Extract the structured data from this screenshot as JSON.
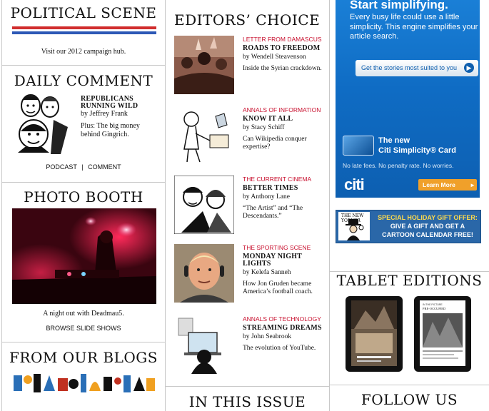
{
  "political_scene": {
    "heading": "Political Scene",
    "caption": "Visit our 2012 campaign hub.",
    "flag_colors": [
      "#d12d2d",
      "#ffffff",
      "#2d58b6"
    ]
  },
  "daily_comment": {
    "heading": "Daily Comment",
    "title": "Republicans Running Wild",
    "byline": "by Jeffrey Frank",
    "plus": "Plus: The big money behind Gingrich.",
    "links": [
      "PODCAST",
      "COMMENT"
    ],
    "separator": "|"
  },
  "photo_booth": {
    "heading": "Photo Booth",
    "caption": "A night out with Deadmau5.",
    "link": "BROWSE SLIDE SHOWS"
  },
  "blogs": {
    "heading": "From Our Blogs"
  },
  "editors_choice": {
    "heading": "Editors’ Choice",
    "items": [
      {
        "kicker": "Letter from Damascus",
        "title": "Roads to Freedom",
        "byline": "by Wendell Steavenson",
        "dek": "Inside the Syrian crackdown."
      },
      {
        "kicker": "Annals of Information",
        "title": "Know It All",
        "byline": "by Stacy Schiff",
        "dek": "Can Wikipedia conquer expertise?"
      },
      {
        "kicker": "The Current Cinema",
        "title": "Better Times",
        "byline": "by Anthony Lane",
        "dek": "“The Artist” and “The Descendants.”"
      },
      {
        "kicker": "The Sporting Scene",
        "title": "Monday Night Lights",
        "byline": "by Kelefa Sanneh",
        "dek": "How Jon Gruden became America’s football coach."
      },
      {
        "kicker": "Annals of Technology",
        "title": "Streaming Dreams",
        "byline": "by John Seabrook",
        "dek": "The evolution of YouTube."
      }
    ]
  },
  "in_this_issue": {
    "heading": "In This Issue"
  },
  "citi_ad": {
    "headline": "Start simplifying.",
    "body": "Every busy life could use a little simplicity. This engine simplifies your article search.",
    "button": "Get the stories most suited to you",
    "new_card_line1": "The new",
    "new_card_line2": "Citi Simplicity® Card",
    "fine": "No late fees. No penalty rate. No worries.",
    "logo": "citi",
    "learn_more": "Learn More",
    "accent": "#1a7fd6",
    "cta_color": "#f0a02a"
  },
  "holiday_banner": {
    "brand": "THE NEW YORKER",
    "line1": "SPECIAL HOLIDAY GIFT OFFER:",
    "line2": "GIVE A GIFT AND GET A",
    "line3": "CARTOON CALENDAR FREE!"
  },
  "tablet_editions": {
    "heading": "Tablet Editions",
    "tablet2_text": "IN THE PICTURE",
    "tablet2_title": "PRE-OCCUPIED"
  },
  "follow_us": {
    "heading": "Follow Us"
  }
}
